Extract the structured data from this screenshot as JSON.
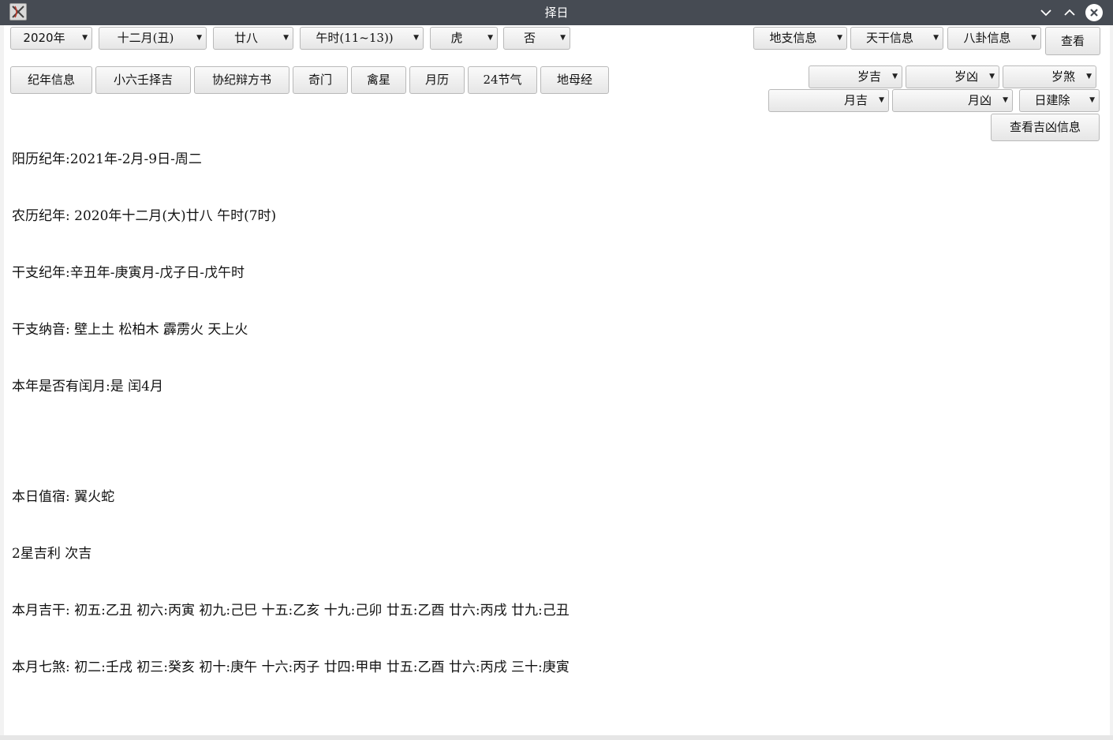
{
  "window": {
    "title": "择日",
    "minimize_icon": "chevron-down-icon",
    "maximize_icon": "chevron-up-icon",
    "close_icon": "close-icon"
  },
  "selectors": {
    "year": "2020年",
    "month": "十二月(丑)",
    "day": "廿八",
    "hour": "午时(11~13))",
    "zodiac": "虎",
    "leap": "否"
  },
  "info_combos": {
    "dizhi": "地支信息",
    "tiangan": "天干信息",
    "bagua": "八卦信息"
  },
  "view_button": "查看",
  "nav_buttons": [
    "纪年信息",
    "小六壬择吉",
    "协纪辩方书",
    "奇门",
    "禽星",
    "月历",
    "24节气",
    "地母经"
  ],
  "jixiong_combos": {
    "sui_ji": "岁吉",
    "sui_xiong": "岁凶",
    "sui_sha": "岁煞",
    "yue_ji": "月吉",
    "yue_xiong": "月凶",
    "ri_jian_chu": "日建除"
  },
  "view_jixiong_button": "查看吉凶信息",
  "output_lines": [
    "阳历纪年:2021年-2月-9日-周二",
    "农历纪年: 2020年十二月(大)廿八 午时(7时)",
    "干支纪年:辛丑年-庚寅月-戊子日-戊午时",
    "干支纳音: 壁上土 松柏木 霹雳火 天上火",
    "本年是否有闰月:是 闰4月",
    "",
    "本日值宿: 翼火蛇",
    "2星吉利 次吉",
    "本月吉干: 初五:乙丑 初六:丙寅 初九:己巳 十五:乙亥 十九:己卯 廿五:乙酉 廿六:丙戌 廿九:己丑",
    "本月七煞: 初二:壬戌 初三:癸亥 初十:庚午 十六:丙子 廿四:甲申 廿五:乙酉 廿六:丙戌 三十:庚寅"
  ]
}
